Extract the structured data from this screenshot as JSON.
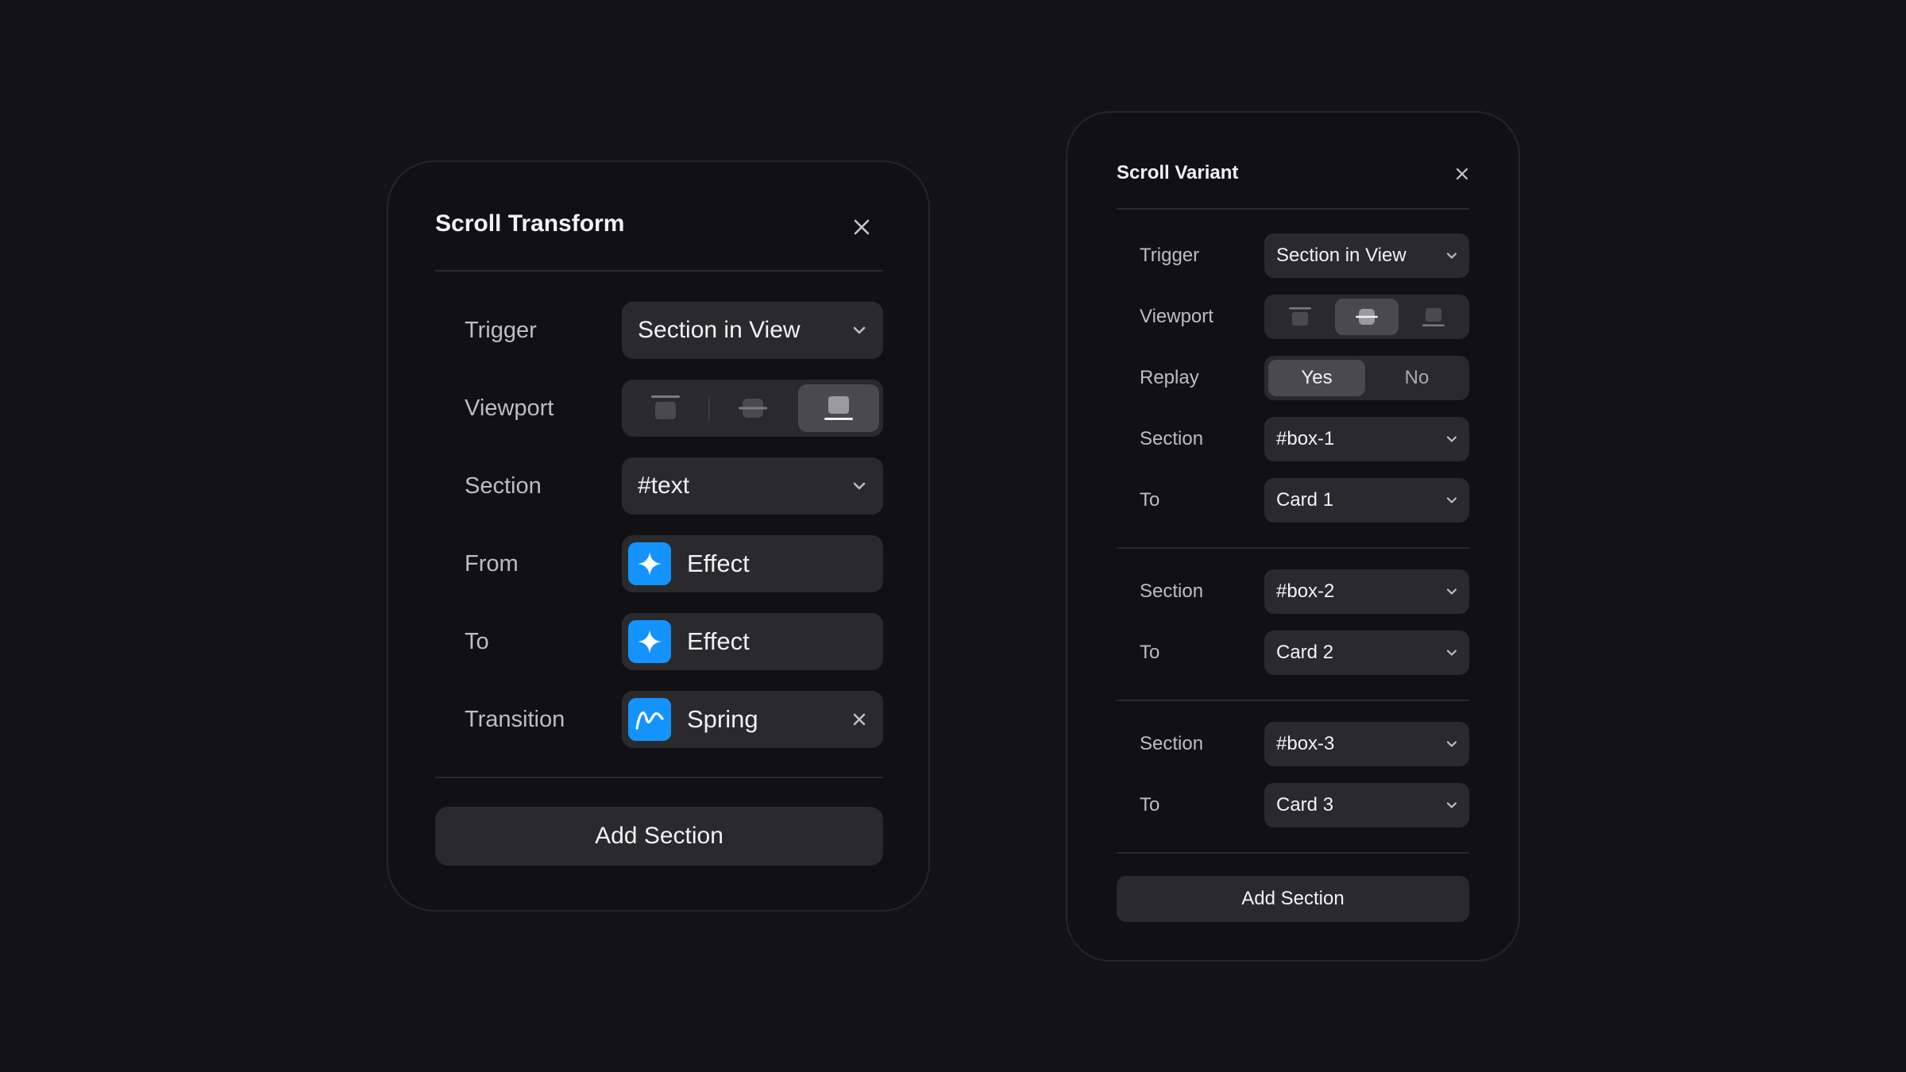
{
  "colors": {
    "background": "#131315",
    "panel": "#111113",
    "control": "#2a2a2d",
    "accent": "#1493ff"
  },
  "transform_panel": {
    "title": "Scroll Transform",
    "close_icon": "close-icon",
    "rows": {
      "trigger": {
        "label": "Trigger",
        "value": "Section in View"
      },
      "viewport": {
        "label": "Viewport",
        "options": [
          "viewport-top-icon",
          "viewport-center-icon",
          "viewport-bottom-icon"
        ],
        "selected": "viewport-bottom-icon"
      },
      "section": {
        "label": "Section",
        "value": "#text"
      },
      "from": {
        "label": "From",
        "value": "Effect",
        "icon": "sparkle-icon"
      },
      "to": {
        "label": "To",
        "value": "Effect",
        "icon": "sparkle-icon"
      },
      "transition": {
        "label": "Transition",
        "value": "Spring",
        "icon": "spring-curve-icon"
      }
    },
    "add_label": "Add Section"
  },
  "variant_panel": {
    "title": "Scroll Variant",
    "close_icon": "close-icon",
    "trigger": {
      "label": "Trigger",
      "value": "Section in View"
    },
    "viewport": {
      "label": "Viewport",
      "options": [
        "viewport-top-icon",
        "viewport-center-icon",
        "viewport-bottom-icon"
      ],
      "selected": "viewport-center-icon"
    },
    "replay": {
      "label": "Replay",
      "options": [
        "Yes",
        "No"
      ],
      "selected": "Yes"
    },
    "sections": [
      {
        "section_label": "Section",
        "section_value": "#box-1",
        "to_label": "To",
        "to_value": "Card 1"
      },
      {
        "section_label": "Section",
        "section_value": "#box-2",
        "to_label": "To",
        "to_value": "Card 2"
      },
      {
        "section_label": "Section",
        "section_value": "#box-3",
        "to_label": "To",
        "to_value": "Card 3"
      }
    ],
    "add_label": "Add Section"
  }
}
